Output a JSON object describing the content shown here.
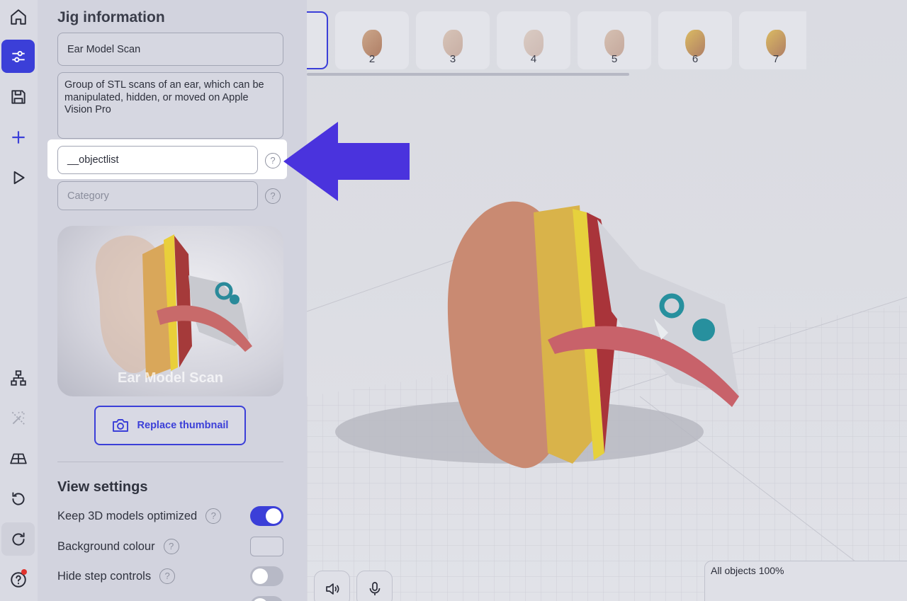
{
  "rail": {
    "items": [
      {
        "icon": "home-icon"
      },
      {
        "icon": "sliders-icon",
        "active": true
      },
      {
        "icon": "save-icon"
      },
      {
        "icon": "plus-icon"
      },
      {
        "icon": "play-icon"
      },
      {
        "icon": "hierarchy-icon"
      },
      {
        "icon": "magic-wand-icon"
      },
      {
        "icon": "floor-grid-icon"
      },
      {
        "icon": "undo-icon"
      },
      {
        "icon": "redo-icon"
      },
      {
        "icon": "help-icon"
      }
    ]
  },
  "panel": {
    "title": "Jig information",
    "name_value": "Ear Model Scan",
    "description_value": "Group of STL scans of an ear, which can be manipulated, hidden, or moved on Apple Vision Pro",
    "tag_value": "__objectlist",
    "category_placeholder": "Category",
    "help_glyph": "?",
    "thumbnail_caption": "Ear Model Scan",
    "replace_thumbnail_label": "Replace thumbnail",
    "view_settings_title": "View settings",
    "settings": [
      {
        "label": "Keep 3D models optimized",
        "state": "on"
      },
      {
        "label": "Background colour",
        "state": "swatch"
      },
      {
        "label": "Hide step controls",
        "state": "off"
      }
    ]
  },
  "viewport": {
    "steps": [
      "",
      "2",
      "3",
      "4",
      "5",
      "6",
      "7"
    ],
    "selected_step_index": 0,
    "status_text": "All objects 100%"
  },
  "colors": {
    "accent": "#3b3fd8",
    "panel_bg": "#d2d3de",
    "highlight_bg": "#ffffff"
  }
}
